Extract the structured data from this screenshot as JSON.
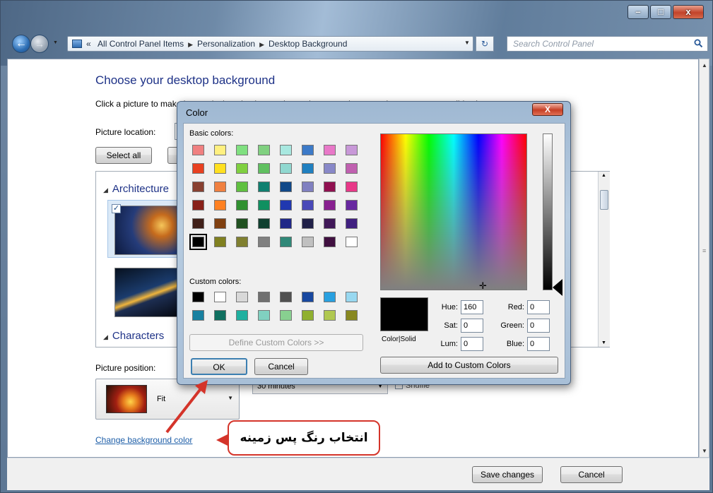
{
  "window": {
    "minimize_glyph": "–",
    "maximize_glyph": "□",
    "close_glyph": "x"
  },
  "nav": {
    "back_glyph": "←",
    "address_prefix": "«",
    "breadcrumb": [
      "All Control Panel Items",
      "Personalization",
      "Desktop Background"
    ],
    "breadcrumb_separator": "▶",
    "search_placeholder": "Search Control Panel"
  },
  "page": {
    "title": "Choose your desktop background",
    "description": "Click a picture to make it your desktop background, or select more than one picture to create a slide show.",
    "picture_location_label": "Picture location:",
    "select_all_label": "Select all",
    "groups": [
      {
        "label": "Architecture"
      },
      {
        "label": "Characters"
      }
    ],
    "picture_position_label": "Picture position:",
    "picture_position_value": "Fit",
    "timer_value": "30 minutes",
    "shuffle_label": "Shuffle",
    "change_color_link": "Change background color"
  },
  "footer": {
    "save_label": "Save changes",
    "cancel_label": "Cancel"
  },
  "color_dialog": {
    "title": "Color",
    "close_glyph": "X",
    "basic_colors_label": "Basic colors:",
    "custom_colors_label": "Custom colors:",
    "basic_colors": [
      [
        "#f08080",
        "#fff080",
        "#80e080",
        "#80d080",
        "#a8e8e0",
        "#3c7ac8",
        "#e878c8",
        "#c898d8"
      ],
      [
        "#e84020",
        "#ffe020",
        "#80d040",
        "#60c060",
        "#90d8d0",
        "#2080c0",
        "#8888c8",
        "#c060b0"
      ],
      [
        "#884030",
        "#f08040",
        "#60c040",
        "#108070",
        "#104888",
        "#8080c0",
        "#901050",
        "#e83888"
      ],
      [
        "#882018",
        "#ff8020",
        "#309030",
        "#109060",
        "#2038b0",
        "#4848b8",
        "#882090",
        "#6828a0"
      ],
      [
        "#402018",
        "#804010",
        "#205020",
        "#104030",
        "#202888",
        "#202048",
        "#401858",
        "#402080"
      ],
      [
        "#000000",
        "#808020",
        "#808030",
        "#808080",
        "#308878",
        "#c0c0c0",
        "#401040",
        "#ffffff"
      ]
    ],
    "custom_colors": [
      [
        "#000000",
        "#ffffff",
        "#d8d8d8",
        "#707070",
        "#505050",
        "#1848a0",
        "#28a0e0",
        "#98d8f0"
      ],
      [
        "#1880a0",
        "#107060",
        "#20b0a0",
        "#80d0c0",
        "#88d090",
        "#90b030",
        "#b0c850",
        "#888820"
      ]
    ],
    "selected_basic": "#000000",
    "define_custom_label": "Define Custom Colors >>",
    "ok_label": "OK",
    "cancel_label": "Cancel",
    "color_solid_label": "Color|Solid",
    "hue_label": "Hue:",
    "hue_value": "160",
    "sat_label": "Sat:",
    "sat_value": "0",
    "lum_label": "Lum:",
    "lum_value": "0",
    "red_label": "Red:",
    "red_value": "0",
    "green_label": "Green:",
    "green_value": "0",
    "blue_label": "Blue:",
    "blue_value": "0",
    "add_custom_label": "Add to Custom Colors",
    "preview_color": "#000000"
  },
  "callout": {
    "text": "انتخاب رنگ پس زمینه",
    "color": "#d4342a"
  }
}
